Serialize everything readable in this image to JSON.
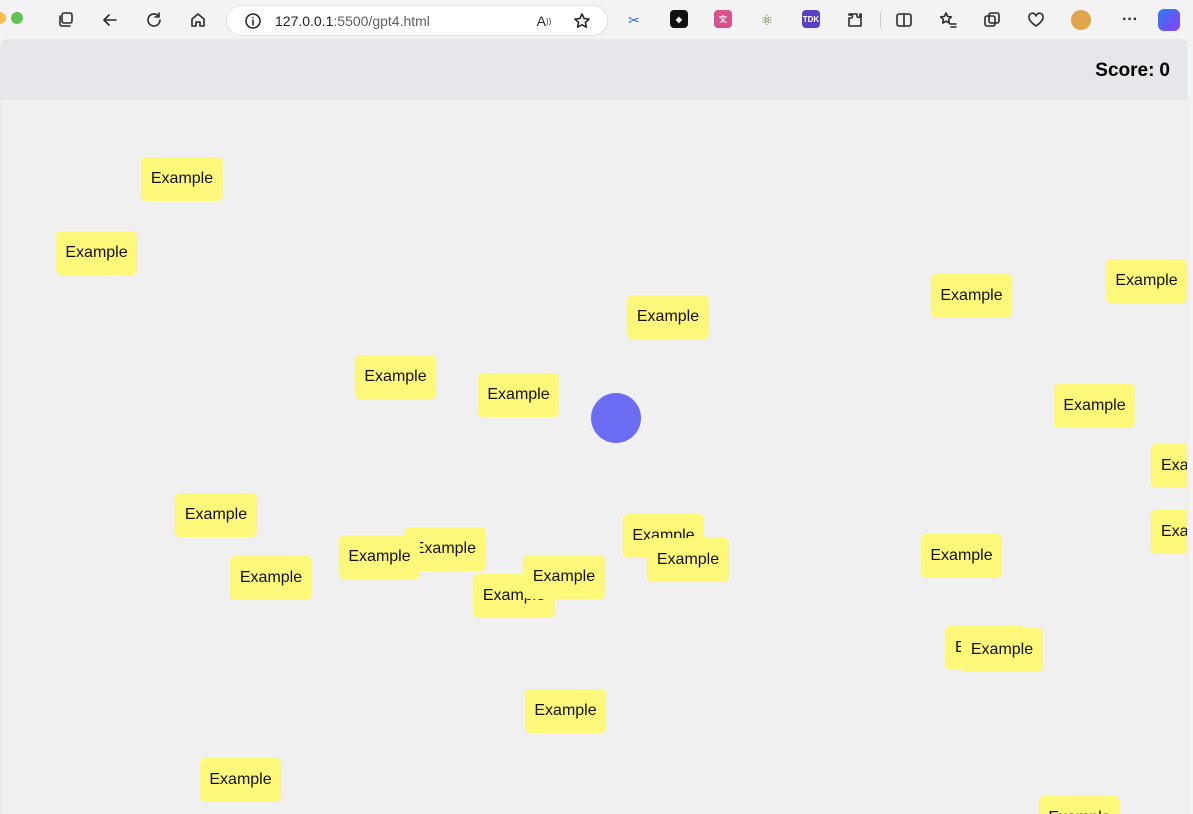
{
  "browser": {
    "url_host": "127.0.0.1",
    "url_path": ":5500/gpt4.html",
    "read_aloud_label": "A",
    "extension_label": "TDK"
  },
  "game": {
    "score_label": "Score:",
    "score_value": "0",
    "word_text": "Example",
    "colors": {
      "word": "#fef87a",
      "player": "#6c6cf2",
      "header": "#e5e7eb"
    }
  }
}
